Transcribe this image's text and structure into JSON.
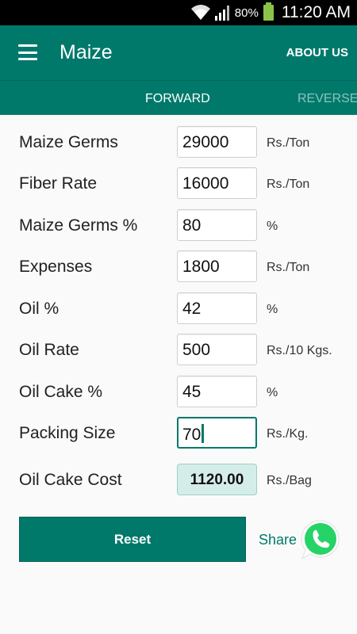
{
  "status_bar": {
    "battery_percent": "80%",
    "time": "11:20 AM"
  },
  "app_bar": {
    "title": "Maize",
    "about_label": "ABOUT US"
  },
  "tabs": [
    {
      "label": "FORWARD",
      "active": true
    },
    {
      "label": "REVERSE",
      "active": false
    }
  ],
  "form": {
    "rows": [
      {
        "label": "Maize Germs",
        "value": "29000",
        "unit": "Rs./Ton"
      },
      {
        "label": "Fiber Rate",
        "value": "16000",
        "unit": "Rs./Ton"
      },
      {
        "label": "Maize Germs %",
        "value": "80",
        "unit": "%"
      },
      {
        "label": "Expenses",
        "value": "1800",
        "unit": "Rs./Ton"
      },
      {
        "label": "Oil %",
        "value": "42",
        "unit": "%"
      },
      {
        "label": "Oil Rate",
        "value": "500",
        "unit": "Rs./10 Kgs."
      },
      {
        "label": "Oil Cake %",
        "value": "45",
        "unit": "%"
      },
      {
        "label": "Packing Size",
        "value": "70",
        "unit": "Rs./Kg."
      }
    ],
    "result": {
      "label": "Oil Cake Cost",
      "value": "1120.00",
      "unit": "Rs./Bag"
    }
  },
  "actions": {
    "reset_label": "Reset",
    "share_label": "Share"
  },
  "colors": {
    "primary": "#00796b",
    "result_bg": "#d5ede8",
    "whatsapp": "#25d366"
  },
  "icons": [
    "wifi-icon",
    "signal-icon",
    "battery-icon",
    "menu-icon",
    "whatsapp-icon"
  ]
}
